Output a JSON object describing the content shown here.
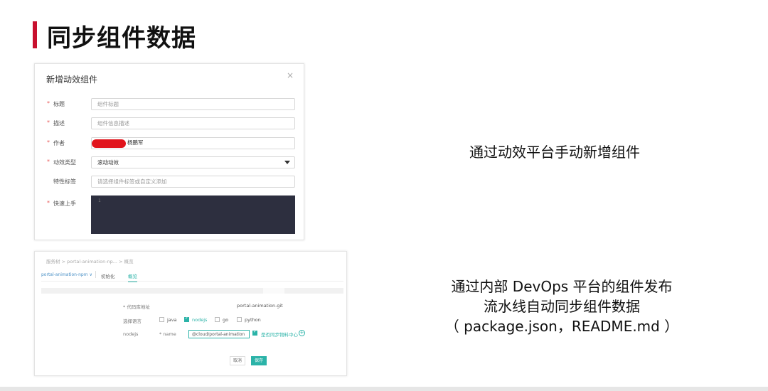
{
  "slide": {
    "title": "同步组件数据"
  },
  "dialog": {
    "title": "新增动效组件",
    "close": "×",
    "fields": {
      "title_label": "标题",
      "title_placeholder": "组件标题",
      "desc_label": "描述",
      "desc_placeholder": "组件信息描述",
      "author_label": "作者",
      "author_value": "杨鹏军",
      "type_label": "动效类型",
      "type_value": "滚动动效",
      "tags_label": "特性标签",
      "tags_placeholder": "请选择组件标签或自定义添加",
      "quickstart_label": "快速上手",
      "code_line": "1"
    },
    "required_mark": "*"
  },
  "devops_form": {
    "breadcrumb": "服务树  >  portal-animation-np...  >  概览",
    "tabs": {
      "branch": "portal-animation-npm ∨",
      "init": "初始化",
      "overview": "概览"
    },
    "repo_label": "* 代码库地址",
    "repo_value": "portal-animation.git",
    "lang_label": "选择语言",
    "langs": [
      "java",
      "nodejs",
      "go",
      "python"
    ],
    "nodejs_label": "nodejs",
    "name_label": "* name",
    "name_value": "@cloud/portal-animation",
    "sync_label": "是否同步物料中心",
    "plus": "+",
    "cancel": "取消",
    "save": "保存"
  },
  "captions": {
    "manual": "通过动效平台手动新增组件",
    "devops_line1": "通过内部 DevOps 平台的组件发布",
    "devops_line2": "流水线自动同步组件数据",
    "devops_line3": "（ package.json，README.md ）"
  }
}
